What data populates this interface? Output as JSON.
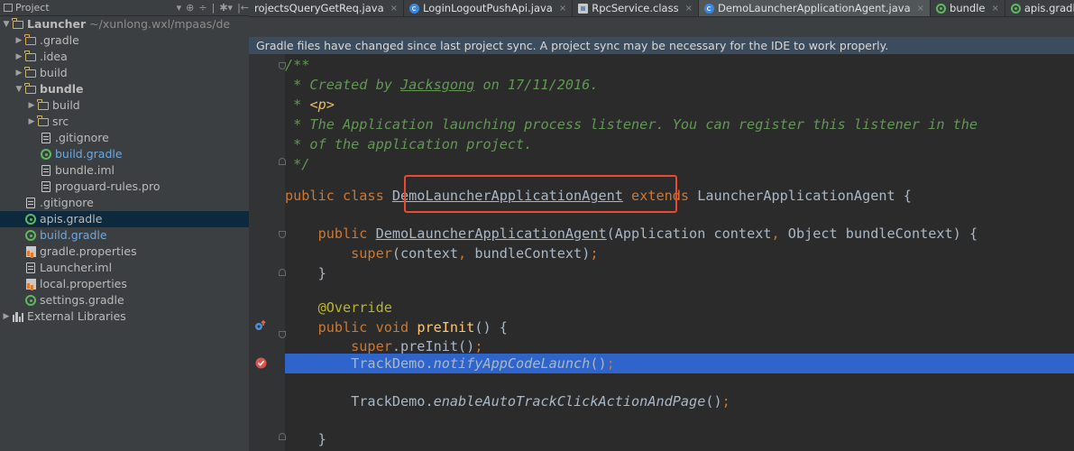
{
  "sidebar": {
    "title": "Project",
    "header_icons": [
      "▾",
      "⊕",
      "÷",
      "|",
      "✱▾",
      "|←"
    ],
    "tree": [
      {
        "label": "Launcher",
        "extra": " ~/xunlong.wxl/mpaas/de",
        "depth": 0,
        "arrow": "▼",
        "icon": "module",
        "bold": true
      },
      {
        "label": ".gradle",
        "depth": 1,
        "arrow": "▶",
        "icon": "folder-orange"
      },
      {
        "label": ".idea",
        "depth": 1,
        "arrow": "▶",
        "icon": "folder"
      },
      {
        "label": "build",
        "depth": 1,
        "arrow": "▶",
        "icon": "folder"
      },
      {
        "label": "bundle",
        "depth": 1,
        "arrow": "▼",
        "icon": "module",
        "bold": true
      },
      {
        "label": "build",
        "depth": 2,
        "arrow": "▶",
        "icon": "folder"
      },
      {
        "label": "src",
        "depth": 2,
        "arrow": "▶",
        "icon": "folder"
      },
      {
        "label": ".gitignore",
        "depth": 2,
        "icon": "file"
      },
      {
        "label": "build.gradle",
        "depth": 2,
        "icon": "gradle",
        "color": "#6fa8dc"
      },
      {
        "label": "bundle.iml",
        "depth": 2,
        "icon": "file"
      },
      {
        "label": "proguard-rules.pro",
        "depth": 2,
        "icon": "file"
      },
      {
        "label": ".gitignore",
        "depth": 1,
        "icon": "file"
      },
      {
        "label": "apis.gradle",
        "depth": 1,
        "icon": "gradle",
        "selected": true
      },
      {
        "label": "build.gradle",
        "depth": 1,
        "icon": "gradle",
        "color": "#6fa8dc"
      },
      {
        "label": "gradle.properties",
        "depth": 1,
        "icon": "prop"
      },
      {
        "label": "Launcher.iml",
        "depth": 1,
        "icon": "file"
      },
      {
        "label": "local.properties",
        "depth": 1,
        "icon": "prop"
      },
      {
        "label": "settings.gradle",
        "depth": 1,
        "icon": "gradle"
      },
      {
        "label": "External Libraries",
        "depth": 0,
        "arrow": "▶",
        "icon": "lib"
      }
    ]
  },
  "tabs": [
    {
      "label": "rojectsQueryGetReq.java",
      "icon": "none",
      "active": false
    },
    {
      "label": "LoginLogoutPushApi.java",
      "icon": "class",
      "active": false
    },
    {
      "label": "RpcService.class",
      "icon": "classfile",
      "active": false
    },
    {
      "label": "DemoLauncherApplicationAgent.java",
      "icon": "class",
      "active": true
    },
    {
      "label": "bundle",
      "icon": "gradle",
      "active": false
    },
    {
      "label": "apis.gradle",
      "icon": "gradle",
      "active": false
    }
  ],
  "tab_close": "×",
  "banner": "Gradle files have changed since last project sync. A project sync may be necessary for the IDE to work properly.",
  "code": {
    "l1": "/**",
    "l2a": " * Created by ",
    "l2b": "Jacksgong",
    "l2c": " on 17/11/2016.",
    "l3a": " * ",
    "l3b": "<p>",
    "l4": " * The Application launching process listener. You can register this listener in the",
    "l5": " * of the application project.",
    "l6": " */",
    "l7a": "public class ",
    "l7b": "DemoLauncherApplicationAgent",
    "l7c": " extends",
    "l7d": " LauncherApplicationAgent {",
    "l8a": "    public ",
    "l8b": "DemoLauncherApplicationAgent",
    "l8c": "(Application context",
    "l8d": ",",
    "l8e": " Object bundleContext) {",
    "l9a": "        super",
    "l9b": "(context",
    "l9c": ",",
    "l9d": " bundleContext)",
    "l9e": ";",
    "l10": "    }",
    "l11": "    @Override",
    "l12a": "    public void ",
    "l12b": "preInit",
    "l12c": "() {",
    "l13a": "        super",
    "l13b": ".preInit()",
    "l13c": ";",
    "l14a": "        TrackDemo.",
    "l14b": "notifyAppCodeLaunch",
    "l14c": "()",
    "l14d": ";",
    "l15a": "        TrackDemo.",
    "l15b": "enableAutoTrackClickActionAndPage",
    "l15c": "()",
    "l15d": ";",
    "l16": "    }"
  }
}
